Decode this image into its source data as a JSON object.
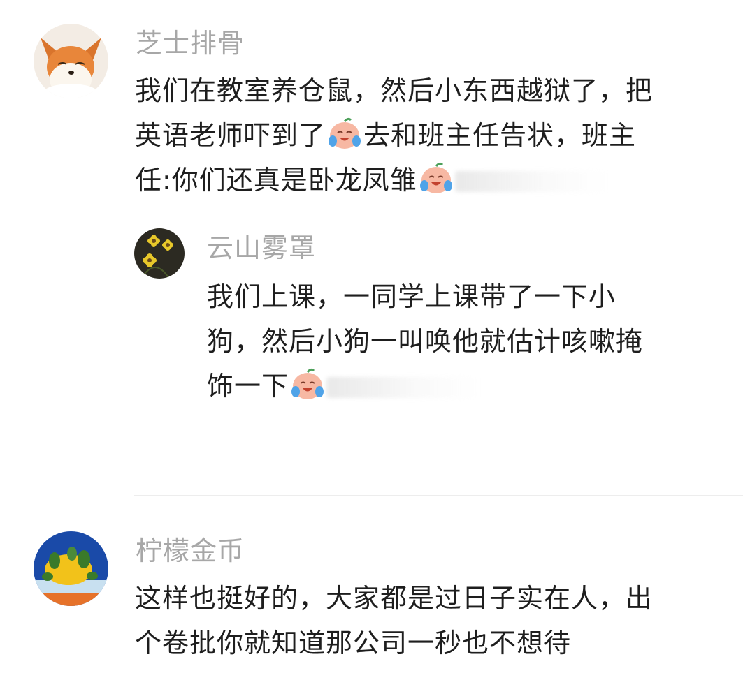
{
  "comments": [
    {
      "username": "芝士排骨",
      "lines": [
        "我们在教室养仓鼠，然后小东西越狱了，把",
        "英语老师吓到了",
        "去和班主任告状，班主",
        "任:你们还真是卧龙凤雏"
      ],
      "emoji": "crying-laugh-emoji",
      "reply": {
        "username": "云山雾罩",
        "lines": [
          "我们上课，一同学上课带了一下小",
          "狗，然后小狗一叫唤他就估计咳嗽掩",
          "饰一下"
        ],
        "emoji": "crying-laugh-emoji"
      }
    },
    {
      "username": "柠檬金币",
      "lines": [
        "这样也挺好的，大家都是过日子实在人，出",
        "个卷批你就知道那公司一秒也不想待"
      ]
    }
  ],
  "colors": {
    "username": "#a7a7a7",
    "text": "#1e1e1e",
    "divider": "#ededed"
  }
}
